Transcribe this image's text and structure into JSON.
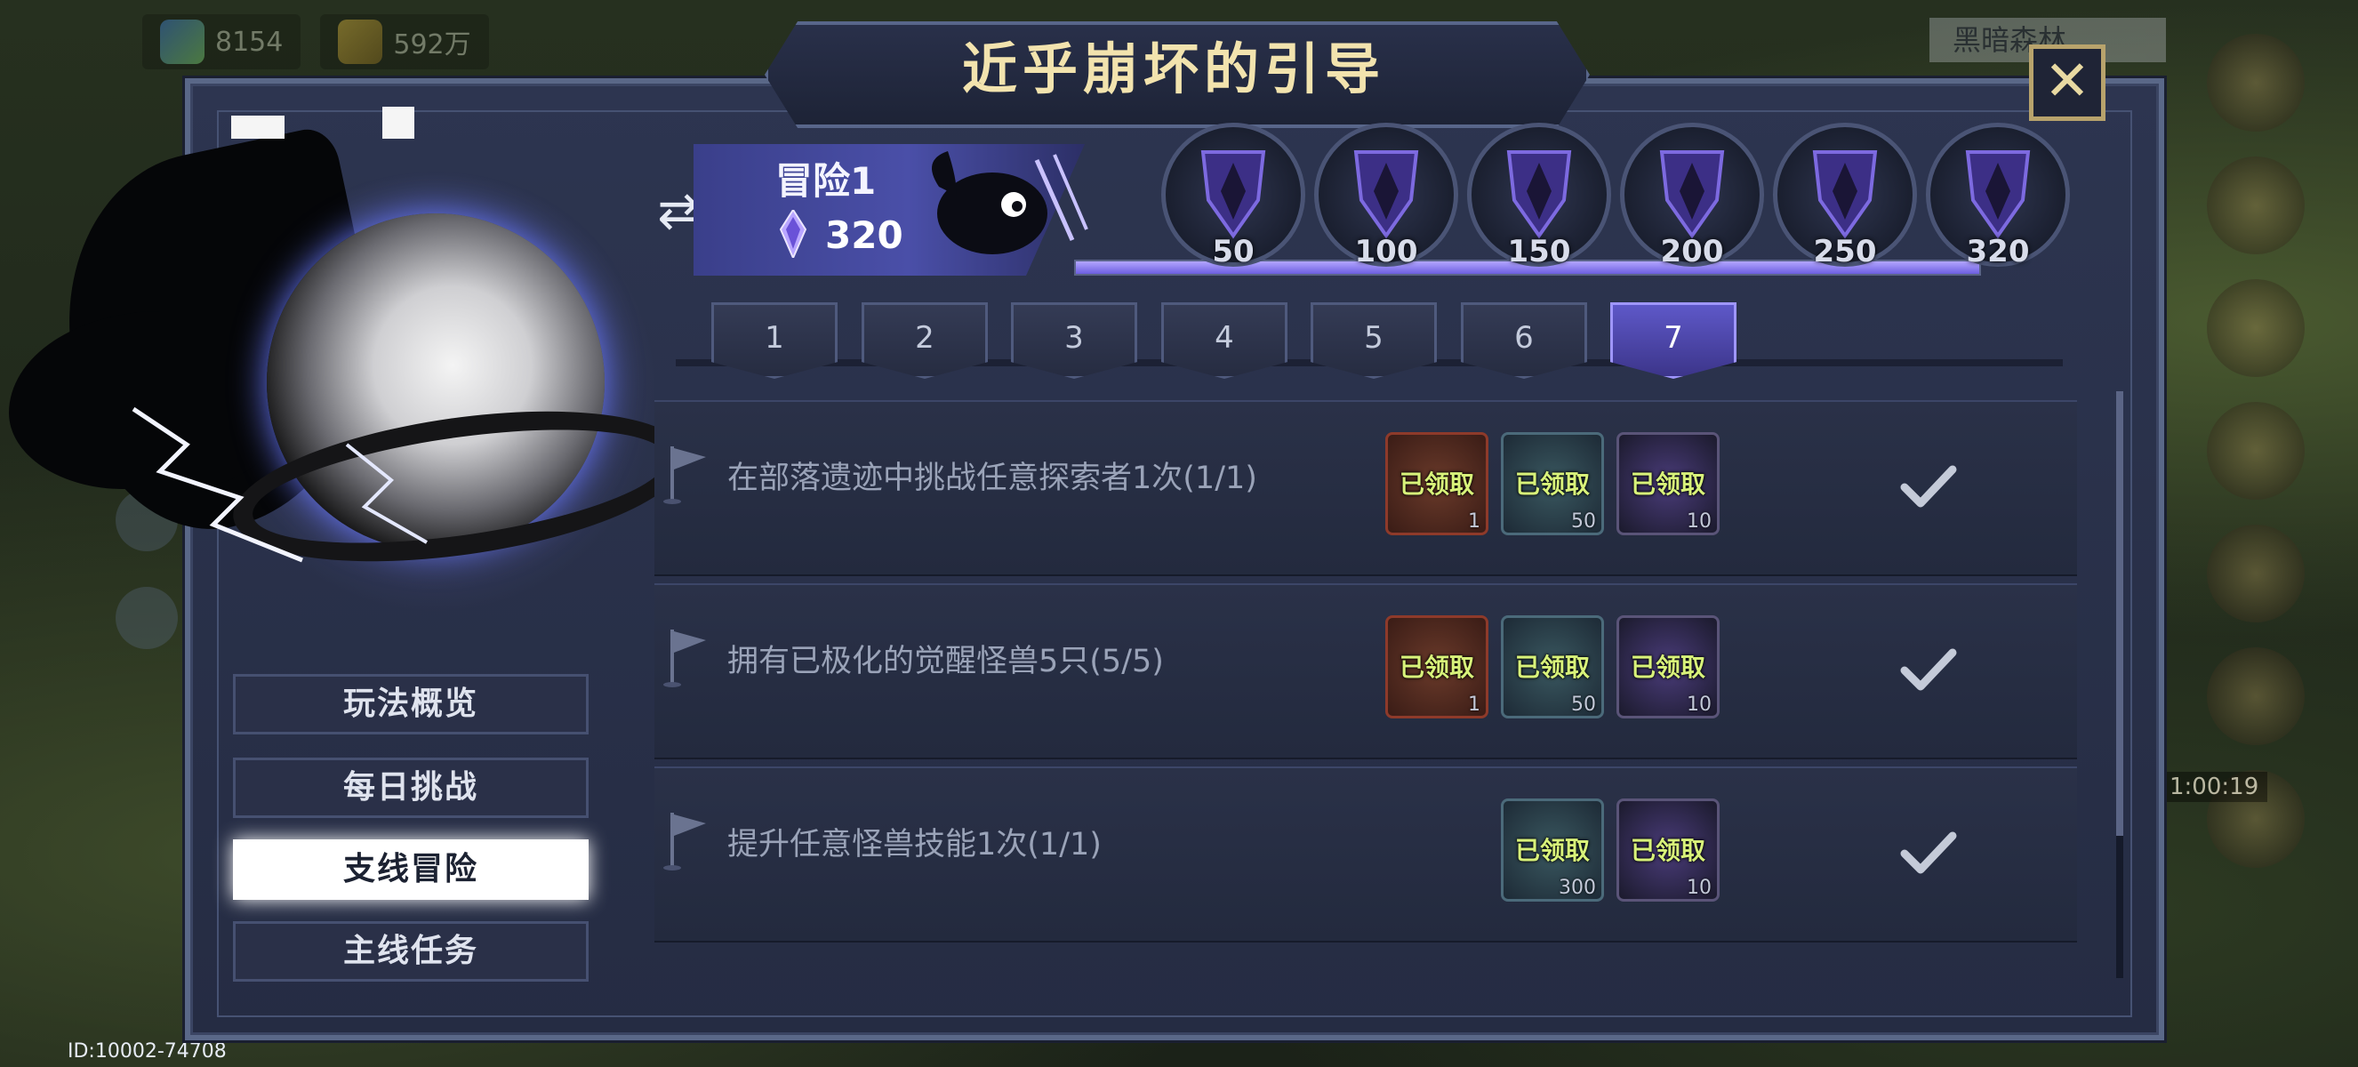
{
  "background": {
    "resource_1": "8154",
    "resource_2": "592万",
    "location": "黑暗森林",
    "timer": "1:00:19"
  },
  "user_id": "ID:10002-74708",
  "title": "近乎崩坏的引导",
  "nav": [
    {
      "label": "玩法概览"
    },
    {
      "label": "每日挑战"
    },
    {
      "label": "支线冒险"
    },
    {
      "label": "主线任务"
    }
  ],
  "nav_active_index": 2,
  "adventure": {
    "name": "冒险1",
    "score": "320"
  },
  "milestones": [
    "50",
    "100",
    "150",
    "200",
    "250",
    "320"
  ],
  "progress": 1.0,
  "tabs": [
    "1",
    "2",
    "3",
    "4",
    "5",
    "6",
    "7"
  ],
  "active_tab_index": 6,
  "tasks": [
    {
      "text": "在部落遗迹中挑战任意探索者1次(1/1)",
      "rewards": [
        {
          "type": "red",
          "label": "已领取",
          "count": "1"
        },
        {
          "type": "teal",
          "label": "已领取",
          "count": "50"
        },
        {
          "type": "purple",
          "label": "已领取",
          "count": "10"
        }
      ],
      "completed": true
    },
    {
      "text": "拥有已极化的觉醒怪兽5只(5/5)",
      "rewards": [
        {
          "type": "red",
          "label": "已领取",
          "count": "1"
        },
        {
          "type": "teal",
          "label": "已领取",
          "count": "50"
        },
        {
          "type": "purple",
          "label": "已领取",
          "count": "10"
        }
      ],
      "completed": true
    },
    {
      "text": "提升任意怪兽技能1次(1/1)",
      "rewards": [
        {
          "type": "teal",
          "label": "已领取",
          "count": "300"
        },
        {
          "type": "purple",
          "label": "已领取",
          "count": "10"
        }
      ],
      "completed": true
    }
  ],
  "colors": {
    "accent": "#5e58c8",
    "title": "#f2e3ae",
    "claimed_text": "#d8f27a"
  }
}
